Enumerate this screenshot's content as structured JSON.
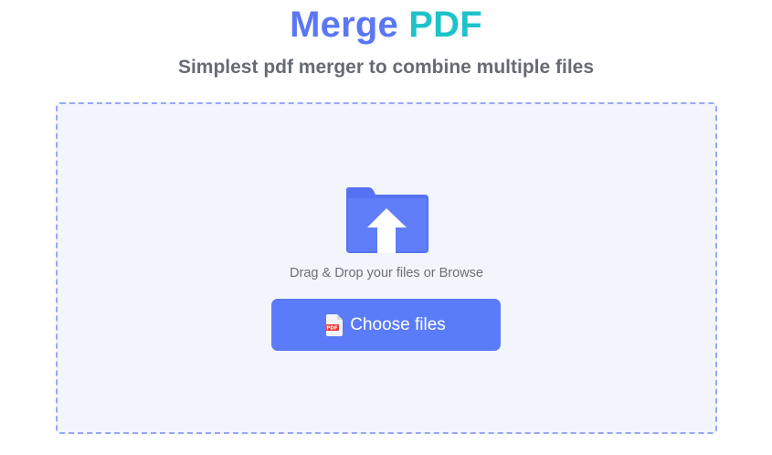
{
  "header": {
    "title_word1": "Merge",
    "title_word2": "PDF",
    "subtitle": "Simplest pdf merger to combine multiple files"
  },
  "dropzone": {
    "icon": "folder-upload-icon",
    "instruction": "Drag & Drop your files or Browse",
    "button_icon": "pdf-file-icon",
    "button_icon_text": "PDF",
    "button_label": "Choose files"
  },
  "colors": {
    "accent_blue": "#5b77f5",
    "accent_teal": "#1ec3c9",
    "button_bg": "#5b7cf8",
    "dropzone_bg": "#f3f5fd",
    "dropzone_border": "#94a9f2"
  }
}
